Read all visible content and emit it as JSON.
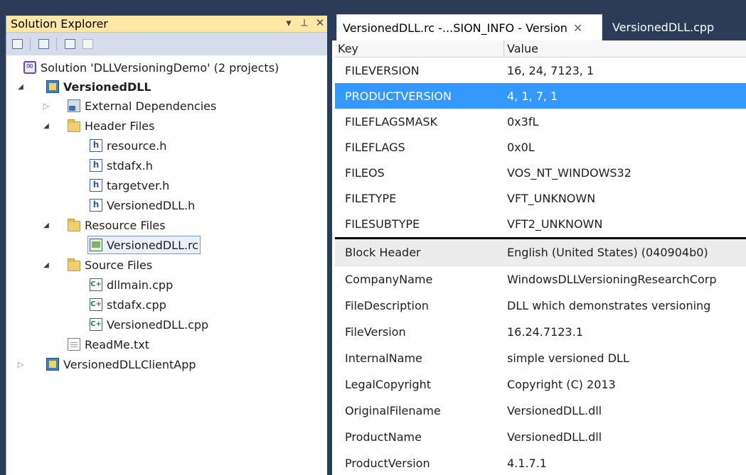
{
  "explorer": {
    "title": "Solution Explorer",
    "controls": [
      "▾",
      "⟂",
      "✕"
    ],
    "toolbar_icons": [
      "properties-icon",
      "show-all-files-icon",
      "view-class-diagram-icon",
      "refresh-icon"
    ],
    "tree": [
      {
        "label": "Solution 'DLLVersioningDemo' (2 projects)",
        "icon": "solution-icon"
      },
      {
        "label": "VersionedDLL",
        "icon": "project-icon",
        "expanded": true,
        "bold": true
      },
      {
        "label": "External Dependencies",
        "icon": "external-dependencies-icon",
        "expanded": false
      },
      {
        "label": "Header Files",
        "icon": "folder-icon",
        "expanded": true
      },
      {
        "label": "resource.h",
        "icon": "header-file-icon"
      },
      {
        "label": "stdafx.h",
        "icon": "header-file-icon"
      },
      {
        "label": "targetver.h",
        "icon": "header-file-icon"
      },
      {
        "label": "VersionedDLL.h",
        "icon": "header-file-icon"
      },
      {
        "label": "Resource Files",
        "icon": "folder-icon",
        "expanded": true
      },
      {
        "label": "VersionedDLL.rc",
        "icon": "resource-file-icon",
        "selected": true
      },
      {
        "label": "Source Files",
        "icon": "folder-icon",
        "expanded": true
      },
      {
        "label": "dllmain.cpp",
        "icon": "cpp-file-icon"
      },
      {
        "label": "stdafx.cpp",
        "icon": "cpp-file-icon"
      },
      {
        "label": "VersionedDLL.cpp",
        "icon": "cpp-file-icon"
      },
      {
        "label": "ReadMe.txt",
        "icon": "text-file-icon"
      },
      {
        "label": "VersionedDLLClientApp",
        "icon": "project-icon",
        "expanded": false
      }
    ]
  },
  "editor": {
    "tabs": [
      {
        "label": "VersionedDLL.rc -...SION_INFO - Version",
        "active": true,
        "close": "✕"
      },
      {
        "label": "VersionedDLL.cpp",
        "active": false
      }
    ],
    "columns": {
      "key": "Key",
      "value": "Value"
    },
    "fixed_rows": [
      {
        "key": "FILEVERSION",
        "value": "16, 24, 7123, 1"
      },
      {
        "key": "PRODUCTVERSION",
        "value": "4, 1, 7, 1",
        "selected": true
      },
      {
        "key": "FILEFLAGSMASK",
        "value": "0x3fL"
      },
      {
        "key": "FILEFLAGS",
        "value": "0x0L"
      },
      {
        "key": "FILEOS",
        "value": "VOS_NT_WINDOWS32"
      },
      {
        "key": "FILETYPE",
        "value": "VFT_UNKNOWN"
      },
      {
        "key": "FILESUBTYPE",
        "value": "VFT2_UNKNOWN"
      }
    ],
    "block_header": {
      "key": "Block Header",
      "value": "English (United States) (040904b0)"
    },
    "string_rows": [
      {
        "key": "CompanyName",
        "value": "WindowsDLLVersioningResearchCorp"
      },
      {
        "key": "FileDescription",
        "value": "DLL which demonstrates versioning"
      },
      {
        "key": "FileVersion",
        "value": "16.24.7123.1"
      },
      {
        "key": "InternalName",
        "value": "simple versioned DLL"
      },
      {
        "key": "LegalCopyright",
        "value": "Copyright (C) 2013"
      },
      {
        "key": "OriginalFilename",
        "value": "VersionedDLL.dll"
      },
      {
        "key": "ProductName",
        "value": "VersionedDLL.dll"
      },
      {
        "key": "ProductVersion",
        "value": "4.1.7.1"
      }
    ]
  }
}
